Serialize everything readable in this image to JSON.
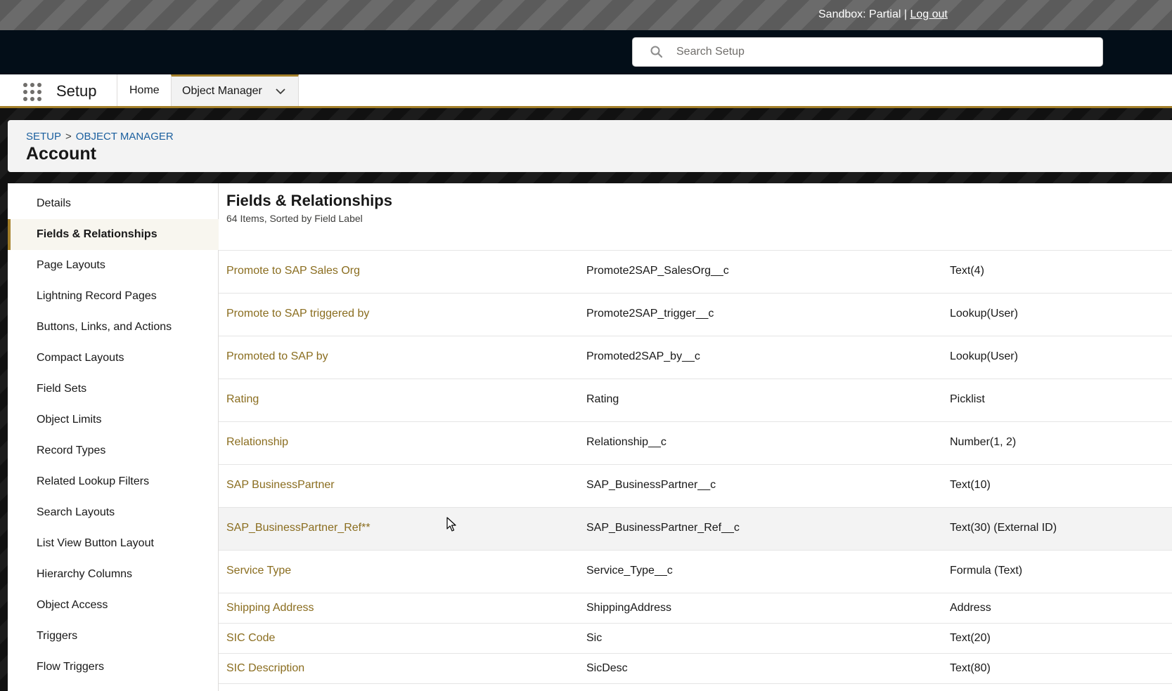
{
  "sandbox": {
    "label": "Sandbox: Partial | ",
    "logout": "Log out"
  },
  "search": {
    "placeholder": "Search Setup"
  },
  "context": {
    "app_name": "Setup",
    "nav_home": "Home",
    "nav_object_manager": "Object Manager"
  },
  "breadcrumb": {
    "setup": "SETUP",
    "separator": ">",
    "object_manager": "OBJECT MANAGER"
  },
  "page_title": "Account",
  "sidebar": {
    "items": [
      {
        "label": "Details"
      },
      {
        "label": "Fields & Relationships",
        "active": true
      },
      {
        "label": "Page Layouts"
      },
      {
        "label": "Lightning Record Pages"
      },
      {
        "label": "Buttons, Links, and Actions"
      },
      {
        "label": "Compact Layouts"
      },
      {
        "label": "Field Sets"
      },
      {
        "label": "Object Limits"
      },
      {
        "label": "Record Types"
      },
      {
        "label": "Related Lookup Filters"
      },
      {
        "label": "Search Layouts"
      },
      {
        "label": "List View Button Layout"
      },
      {
        "label": "Hierarchy Columns"
      },
      {
        "label": "Object Access"
      },
      {
        "label": "Triggers"
      },
      {
        "label": "Flow Triggers"
      }
    ]
  },
  "content": {
    "title": "Fields & Relationships",
    "subtitle": "64 Items, Sorted by Field Label",
    "rows": [
      {
        "label": "Promote to SAP Sales Org",
        "api_name": "Promote2SAP_SalesOrg__c",
        "type": "Text(4)"
      },
      {
        "label": "Promote to SAP triggered by",
        "api_name": "Promote2SAP_trigger__c",
        "type": "Lookup(User)"
      },
      {
        "label": "Promoted to SAP by",
        "api_name": "Promoted2SAP_by__c",
        "type": "Lookup(User)"
      },
      {
        "label": "Rating",
        "api_name": "Rating",
        "type": "Picklist"
      },
      {
        "label": "Relationship",
        "api_name": "Relationship__c",
        "type": "Number(1, 2)"
      },
      {
        "label": "SAP BusinessPartner",
        "api_name": "SAP_BusinessPartner__c",
        "type": "Text(10)"
      },
      {
        "label": "SAP_BusinessPartner_Ref**",
        "api_name": "SAP_BusinessPartner_Ref__c",
        "type": "Text(30) (External ID)",
        "hovered": true
      },
      {
        "label": "Service Type",
        "api_name": "Service_Type__c",
        "type": "Formula (Text)"
      },
      {
        "label": "Shipping Address",
        "api_name": "ShippingAddress",
        "type": "Address"
      },
      {
        "label": "SIC Code",
        "api_name": "Sic",
        "type": "Text(20)"
      },
      {
        "label": "SIC Description",
        "api_name": "SicDesc",
        "type": "Text(80)"
      }
    ]
  },
  "colors": {
    "accent": "#a4802a",
    "link": "#8a6d1f",
    "header_bg": "#030e18"
  },
  "icons": {
    "search": "search-icon",
    "app_launcher": "waffle-icon",
    "dropdown": "chevron-down-icon",
    "pointer": "mouse-cursor-icon"
  }
}
